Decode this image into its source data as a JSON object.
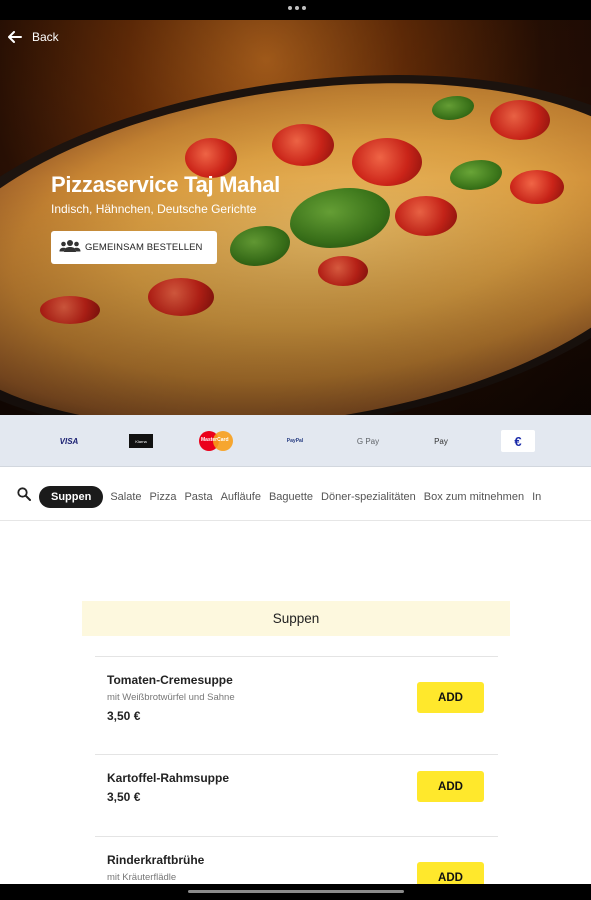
{
  "header": {
    "back_label": "Back",
    "restaurant_name": "Pizzaservice Taj Mahal",
    "cuisines": "Indisch, Hähnchen, Deutsche Gerichte",
    "group_order_label": "GEMEINSAM BESTELLEN"
  },
  "payment_methods": {
    "visa": "VISA",
    "klarna": "Klarna",
    "mastercard": "MasterCard",
    "paypal": "PayPal",
    "gpay": "G Pay",
    "apay": " Pay",
    "cash": "€"
  },
  "categories": {
    "items": [
      "Suppen",
      "Salate",
      "Pizza",
      "Pasta",
      "Aufläufe",
      "Baguette",
      "Döner-spezialitäten",
      "Box zum mitnehmen",
      "In"
    ]
  },
  "menu": {
    "section_title": "Suppen",
    "add_label": "ADD",
    "items": [
      {
        "name": "Tomaten-Cremesuppe",
        "description": "mit Weißbrotwürfel und Sahne",
        "price": "3,50 €"
      },
      {
        "name": "Kartoffel-Rahmsuppe",
        "description": "",
        "price": "3,50 €"
      },
      {
        "name": "Rinderkraftbrühe",
        "description": "mit Kräuterflädle",
        "price": ""
      }
    ]
  },
  "colors": {
    "accent_add": "#ffe82c",
    "section_bg": "#fdf8de",
    "active_chip": "#1b1b1b",
    "payment_bar": "#e3e8f0"
  }
}
